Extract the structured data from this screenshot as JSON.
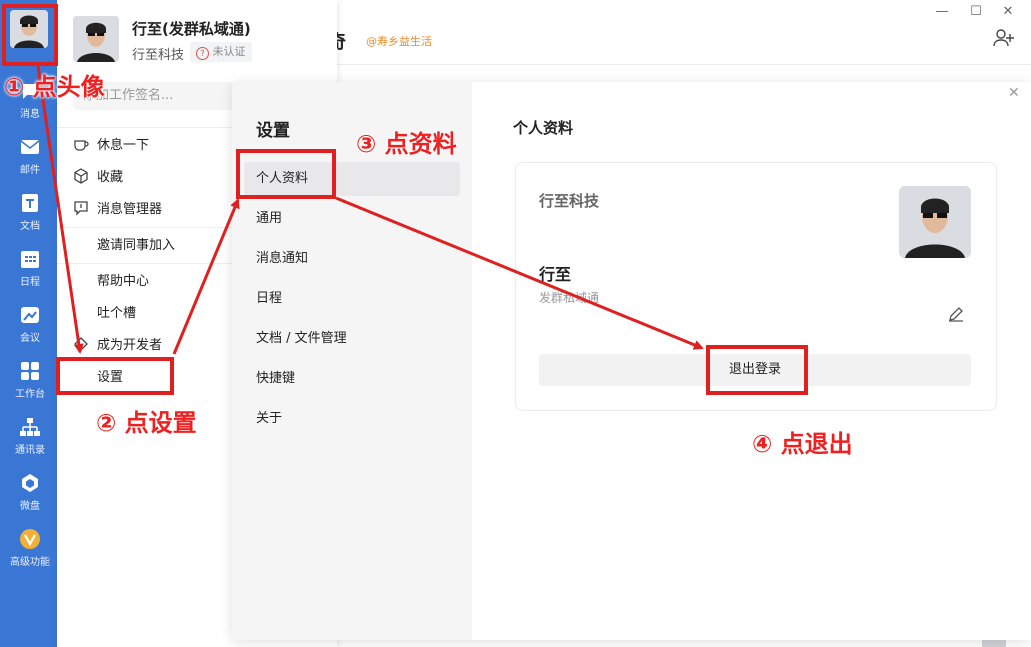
{
  "window": {
    "partial_title": "奇",
    "org_tag": "@寿乡益生活"
  },
  "nav": {
    "items": [
      {
        "label": "消息",
        "icon": "message-icon"
      },
      {
        "label": "邮件",
        "icon": "mail-icon"
      },
      {
        "label": "文档",
        "icon": "document-icon"
      },
      {
        "label": "日程",
        "icon": "calendar-icon"
      },
      {
        "label": "会议",
        "icon": "meeting-icon"
      },
      {
        "label": "工作台",
        "icon": "workbench-icon"
      },
      {
        "label": "通讯录",
        "icon": "contacts-icon"
      },
      {
        "label": "微盘",
        "icon": "drive-icon"
      },
      {
        "label": "高级功能",
        "icon": "advanced-icon"
      }
    ]
  },
  "profile": {
    "name": "行至(发群私域通)",
    "company": "行至科技",
    "badge": "未认证",
    "signature_placeholder": "添加工作签名..."
  },
  "menu": {
    "rest": "休息一下",
    "favorites": "收藏",
    "message_manager": "消息管理器",
    "invite": "邀请同事加入",
    "help": "帮助中心",
    "feedback": "吐个槽",
    "developer": "成为开发者",
    "settings": "设置"
  },
  "settings_panel": {
    "title": "设置",
    "items": [
      "个人资料",
      "通用",
      "消息通知",
      "日程",
      "文档 / 文件管理",
      "快捷键",
      "关于"
    ]
  },
  "profile_page": {
    "title": "个人资料",
    "company": "行至科技",
    "name": "行至",
    "subtitle": "发群私域通",
    "logout": "退出登录"
  },
  "annotations": {
    "step1": "① 点头像",
    "step2": "② 点设置",
    "step3": "③ 点资料",
    "step4": "④ 点退出"
  },
  "colors": {
    "nav_bg": "#3a77d4",
    "annotation_red": "#e02020",
    "badge_text": "#888888",
    "org_tag": "#f08a24"
  }
}
